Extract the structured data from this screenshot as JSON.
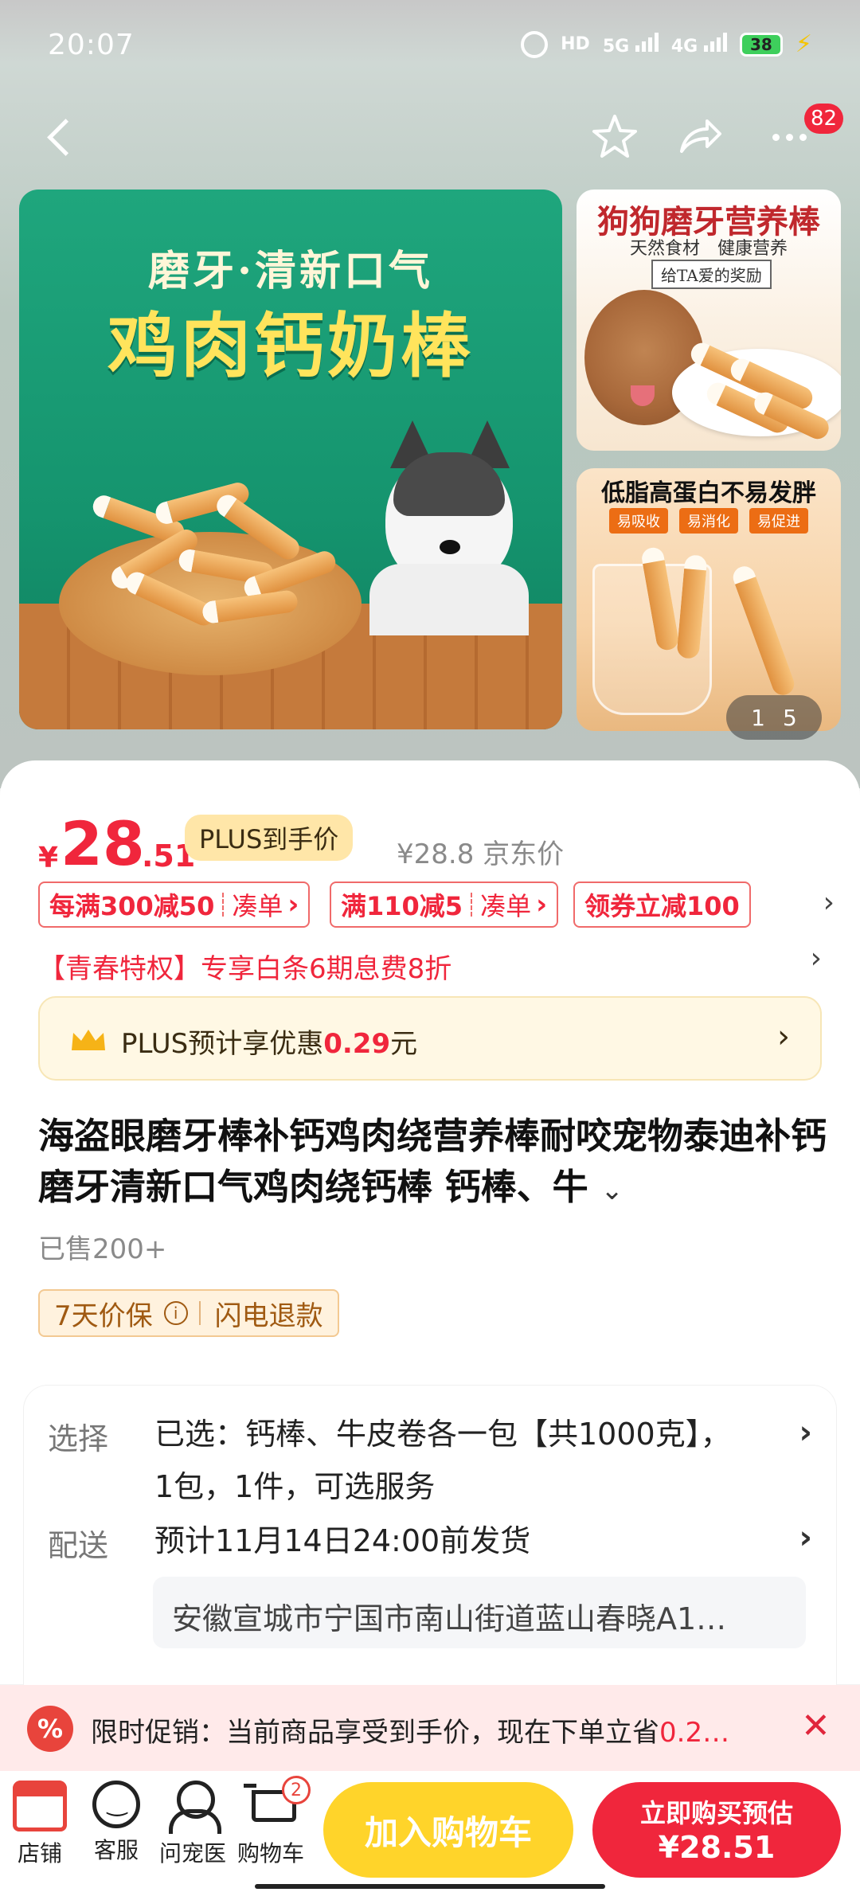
{
  "status": {
    "time": "20:07",
    "hd": "HD",
    "net5g": "5G",
    "net4g": "4G",
    "battery": "38"
  },
  "nav": {
    "badge": "82"
  },
  "gallery": {
    "hero_sub": "磨牙·清新口气",
    "hero_title": "鸡肉钙奶棒",
    "thumb1_title": "狗狗磨牙营养棒",
    "thumb1_sub": "天然食材　健康营养",
    "thumb1_tag": "给TA爱的奖励",
    "thumb2_title": "低脂高蛋白不易发胖",
    "thumb2_tags": [
      "易吸收",
      "易消化",
      "易促进"
    ],
    "pager_current": "1",
    "pager_total": "5"
  },
  "price": {
    "symbol": "¥",
    "integer": "28",
    "decimal": ".51",
    "plus_tag": "PLUS到手价",
    "jd_price": "¥28.8 京东价"
  },
  "coupons": [
    {
      "main": "每满300减50",
      "sub": "凑单"
    },
    {
      "main": "满110减5",
      "sub": "凑单"
    },
    {
      "main": "领券立减100"
    }
  ],
  "youth": "【青春特权】专享白条6期息费8折",
  "plus_banner": {
    "prefix": "PLUS预计享优惠",
    "amount": "0.29",
    "suffix": "元"
  },
  "product": {
    "title": "海盗眼磨牙棒补钙鸡肉绕营养棒耐咬宠物泰迪补钙磨牙清新口气鸡肉绕钙棒 钙棒、牛",
    "sold": "已售200+",
    "guarantee": "7天价保",
    "refund": "闪电退款"
  },
  "spec": {
    "select_label": "选择",
    "select_text": "已选：钙棒、牛皮卷各一包【共1000克】，1包，1件，可选服务",
    "ship_label": "配送",
    "ship_text": "预计11月14日24:00前发货",
    "address": "安徽宣城市宁国市南山街道蓝山春晓A1…"
  },
  "promo": {
    "icon": "%",
    "text": "限时促销：当前商品享受到手价，现在下单立省",
    "highlight": "0.2…"
  },
  "bottom": {
    "shop": "店铺",
    "service": "客服",
    "vet": "问宠医",
    "cart": "购物车",
    "cart_count": "2",
    "add_cart": "加入购物车",
    "buy_line1": "立即购买预估",
    "buy_line2": "¥28.51"
  },
  "colors": {
    "accent": "#f0263c",
    "plus_gold": "#ffe6a8",
    "cart_yellow": "#ffd42a"
  }
}
